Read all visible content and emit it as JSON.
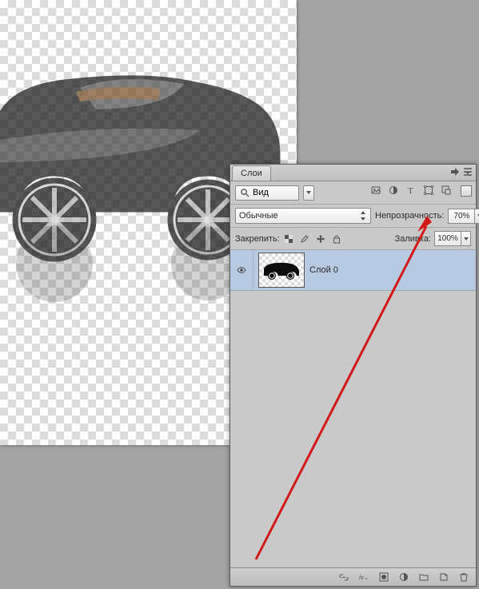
{
  "panel": {
    "tab": "Слои",
    "search_label": "Вид",
    "blend_mode": "Обычные",
    "opacity_label": "Непрозрачность:",
    "opacity_value": "70%",
    "lock_label": "Закрепить:",
    "fill_label": "Заливка:",
    "fill_value": "100%",
    "layer0_name": "Слой 0"
  },
  "icons": {
    "search": "search-icon",
    "filter_drop": "filter-dropdown-icon",
    "pixel_filter": "pixel-filter-icon",
    "adjustment": "adjustment-icon",
    "type": "type-icon",
    "shape": "shape-icon",
    "smart": "smartobject-icon",
    "lock_trans": "lock-transparency-icon",
    "lock_paint": "lock-paint-icon",
    "lock_move": "lock-move-icon",
    "lock_all": "lock-all-icon",
    "eye": "eye-icon",
    "link": "link-icon",
    "fx": "fx-icon",
    "mask": "mask-icon",
    "adj": "adjustment-layer-icon",
    "group": "group-icon",
    "new": "new-layer-icon",
    "trash": "trash-icon",
    "menu": "panel-menu-icon",
    "collapse": "collapse-icon"
  },
  "annotation": {
    "arrow_color": "#d21818"
  }
}
